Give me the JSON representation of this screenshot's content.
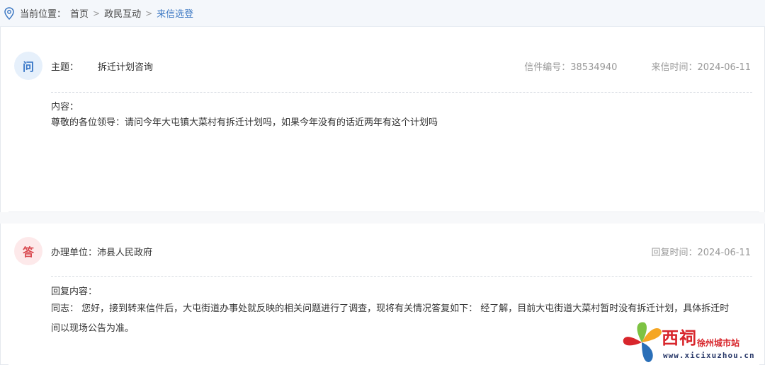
{
  "breadcrumb": {
    "prefix": "当前位置：",
    "items": [
      "首页",
      "政民互动",
      "来信选登"
    ],
    "separator": ">"
  },
  "question": {
    "badge": "问",
    "subject_label": "主题：",
    "subject": "拆迁计划咨询",
    "letter_no": "信件编号：38534940",
    "date": "来信时间：2024-06-11",
    "content_label": "内容：",
    "content": "尊敬的各位领导：请问今年大屯镇大菜村有拆迁计划吗，如果今年没有的话近两年有这个计划吗"
  },
  "answer": {
    "badge": "答",
    "unit": "办理单位：沛县人民政府",
    "date": "回复时间：2024-06-11",
    "content_label": "回复内容：",
    "content_line1": "同志： 您好，接到转来信件后，大屯街道办事处就反映的相关问题进行了调查，现将有关情况答复如下： 经了解，目前大屯街道大菜村暂时没有拆迁计划，具体拆迁时",
    "content_line2": "间以现场公告为准。"
  },
  "watermark": {
    "brand": "西祠",
    "sub": "徐州城市站",
    "url": "www.xicixuzhou.cn"
  },
  "colors": {
    "accent": "#3c78c3",
    "answer_red": "#d94a50",
    "meta_gray": "#999999"
  }
}
